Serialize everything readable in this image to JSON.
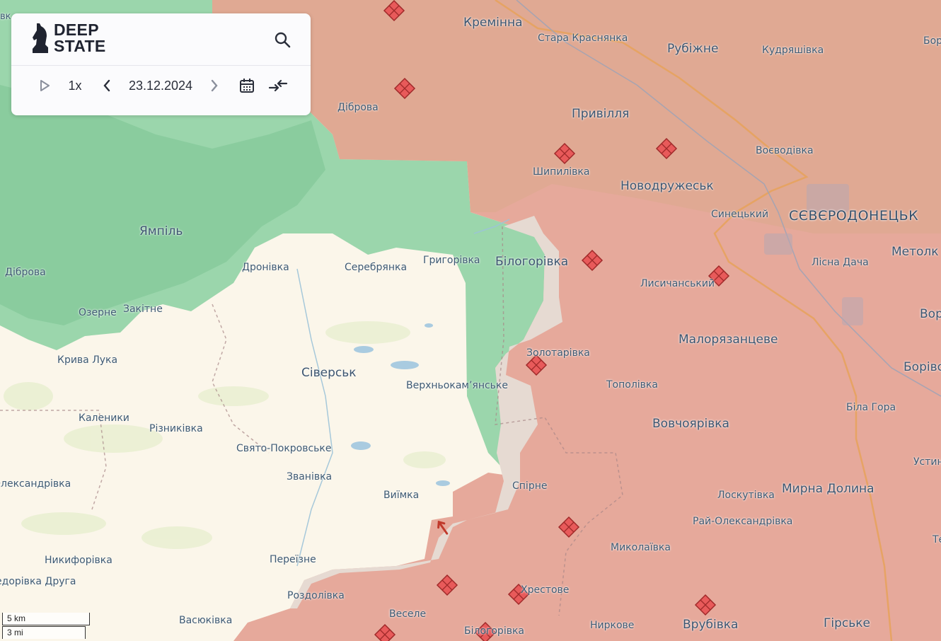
{
  "app": {
    "logo_line1": "DEEP",
    "logo_line2": "STATE"
  },
  "controls": {
    "speed": "1x",
    "date": "23.12.2024",
    "icons": [
      "play-icon",
      "prev-icon",
      "next-icon",
      "calendar-icon",
      "collapse-icon",
      "search-icon"
    ]
  },
  "colors": {
    "occupied": "#e6a99b",
    "ukraine_controlled": "#fbf6ea",
    "liberated": "#93d3a6",
    "contested": "#e6dad2",
    "marker": "#e85a5a"
  },
  "labels": {
    "kreminna": "Кремінна",
    "stara_krasnianka": "Стара Краснянка",
    "rubizhne": "Рубіжне",
    "kudriashivka": "Кудряшівка",
    "bor": "Бор",
    "dibrova_n": "Діброва",
    "pryvillia": "Привілля",
    "voievodivka": "Воєводівка",
    "shypylivka": "Шипилівка",
    "novodruzhesk": "Новодружеськ",
    "synetskyi": "Синецький",
    "sievierodonetsk": "СЄВЄРОДОНЕЦЬК",
    "yampil": "Ямпіль",
    "metolk": "Метолк",
    "lisna_dacha": "Лісна Дача",
    "dibrova_w": "Діброва",
    "dronivka": "Дронівка",
    "serebrianka": "Серебрянка",
    "hryhorivka": "Григорівка",
    "bilohorivka": "Білогорівка",
    "lysychanskyi": "Лисичанський",
    "vor": "Вор",
    "ozerne": "Озерне",
    "zakitne": "Закітне",
    "maloriazantseve": "Малорязанцеве",
    "zolotarivka": "Золотарівка",
    "kryva_luka": "Крива Лука",
    "siversk": "Сіверськ",
    "verkhnokamianske": "Верхньокам’янське",
    "topolivka": "Тополівка",
    "borivske": "Борівсь",
    "bila_hora": "Біла Гора",
    "kalenyky": "Каленики",
    "riznykivka": "Різниківка",
    "vovchoiarivka": "Вовчоярівка",
    "svyato_pokrovske": "Свято-Покровське",
    "ustyn": "Устин",
    "oleksandrivka": "Олександрівка",
    "zvanivka": "Званівка",
    "spirne": "Спірне",
    "loskutivka": "Лоскутівка",
    "myrna_dolyna": "Мирна Долина",
    "vyimka": "Виїмка",
    "rai_oleksandrivka": "Рай-Олександрівка",
    "nykyforivka": "Никифорівка",
    "mykolaivka": "Миколаївка",
    "pereizne": "Переїзне",
    "fedorivka_druha": "Федорівка Друга",
    "te": "Те",
    "khrestove": "Хрестове",
    "rozdolivka": "Роздолівка",
    "vesele": "Веселе",
    "vasiukivka": "Васюківка",
    "nyrkove": "Ниркове",
    "vrubivka": "Врубівка",
    "hirske": "Гірське",
    "bilohorivka_s": "Білогорівка",
    "vk": "вк"
  },
  "scale": {
    "km": "5 km",
    "mi": "3 mi"
  }
}
